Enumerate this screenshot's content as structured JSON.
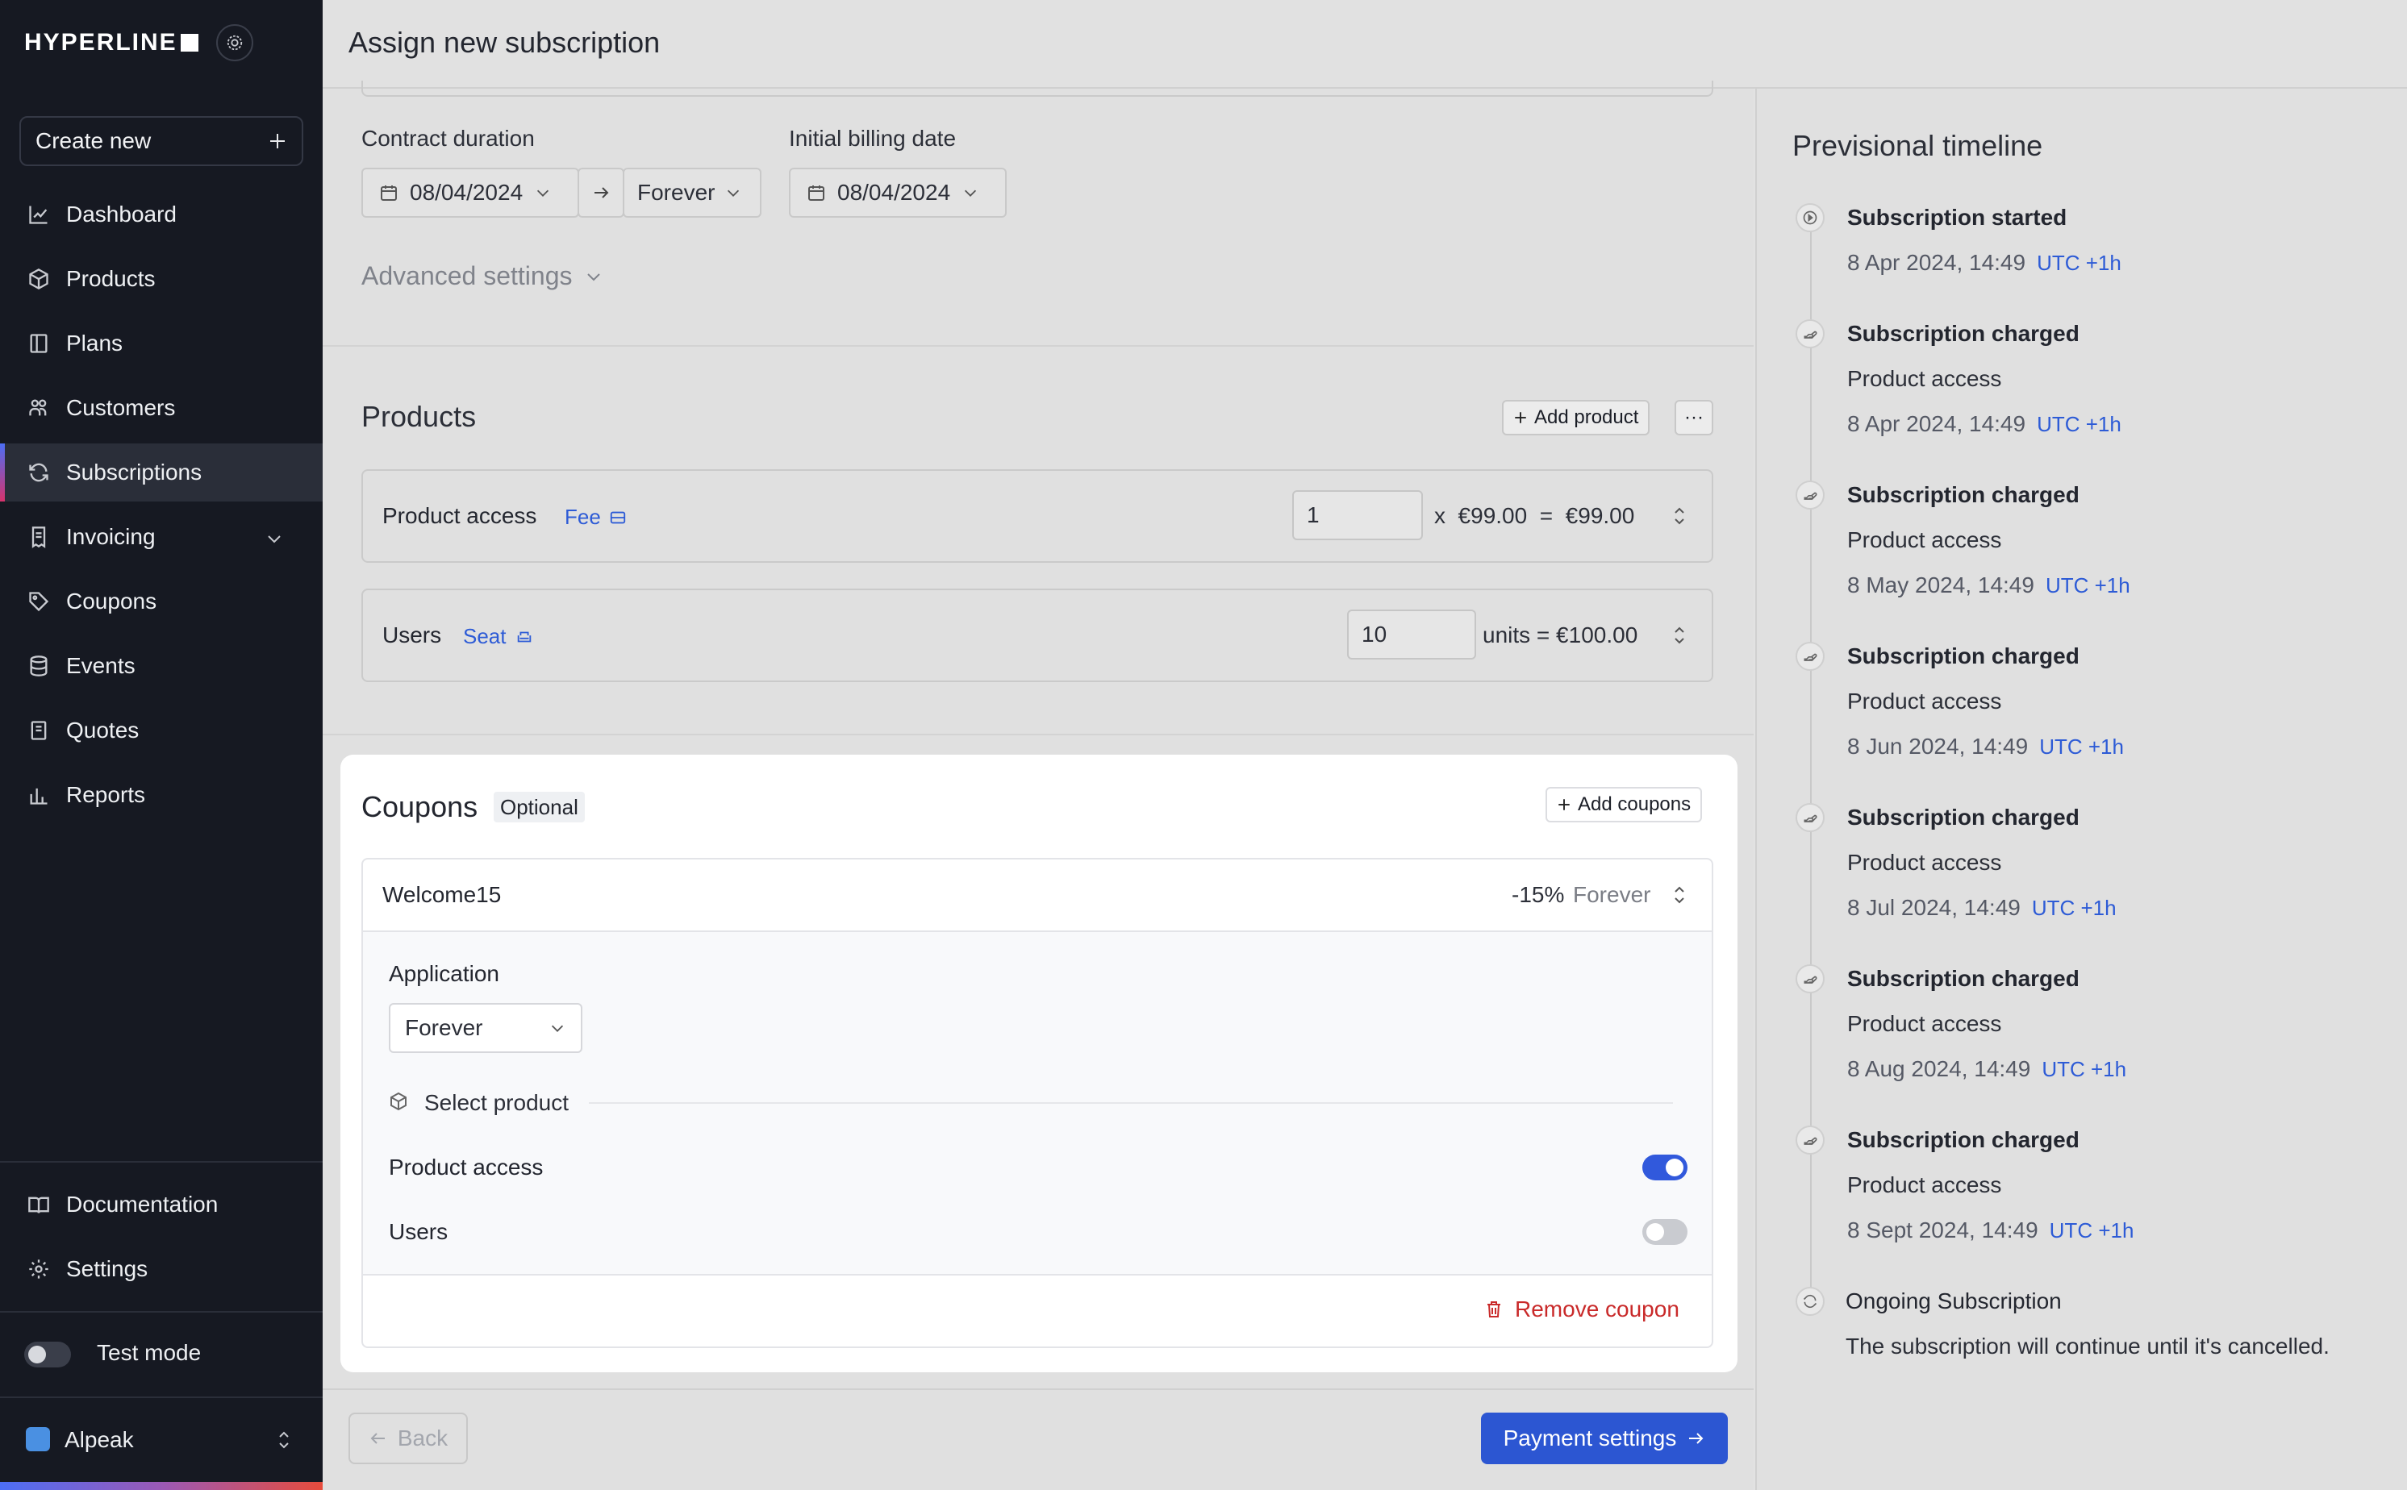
{
  "app": {
    "brand": "HYPERLINE",
    "title": "Assign new subscription"
  },
  "sidebar": {
    "create_new": "Create new",
    "items": [
      {
        "label": "Dashboard",
        "icon": "chart-line-icon"
      },
      {
        "label": "Products",
        "icon": "cube-icon"
      },
      {
        "label": "Plans",
        "icon": "plan-icon"
      },
      {
        "label": "Customers",
        "icon": "users-icon"
      },
      {
        "label": "Subscriptions",
        "icon": "refresh-icon",
        "active": true
      },
      {
        "label": "Invoicing",
        "icon": "receipt-icon"
      },
      {
        "label": "Coupons",
        "icon": "tag-icon"
      },
      {
        "label": "Events",
        "icon": "database-icon"
      },
      {
        "label": "Quotes",
        "icon": "document-icon"
      },
      {
        "label": "Reports",
        "icon": "bar-chart-icon"
      }
    ],
    "bottom_items": [
      {
        "label": "Documentation",
        "icon": "book-icon"
      },
      {
        "label": "Settings",
        "icon": "gear-icon"
      }
    ],
    "test_mode": "Test mode",
    "org_name": "Alpeak"
  },
  "contract": {
    "duration_label": "Contract duration",
    "start_date": "08/04/2024",
    "end_value": "Forever",
    "billing_label": "Initial billing date",
    "billing_date": "08/04/2024",
    "advanced": "Advanced settings"
  },
  "products": {
    "title": "Products",
    "add_button": "Add product",
    "more": "···",
    "rows": [
      {
        "name": "Product access",
        "type": "Fee",
        "qty": "1",
        "price_text": "x  €99.00  =  €99.00"
      },
      {
        "name": "Users",
        "type": "Seat",
        "qty": "10",
        "price_text": "units = €100.00"
      }
    ]
  },
  "coupons": {
    "title": "Coupons",
    "badge": "Optional",
    "add_button": "Add coupons",
    "coupon_name": "Welcome15",
    "discount": "-15%",
    "duration": "Forever",
    "application_label": "Application",
    "application_value": "Forever",
    "select_product": "Select product",
    "products": [
      {
        "name": "Product access",
        "enabled": true
      },
      {
        "name": "Users",
        "enabled": false
      }
    ],
    "remove": "Remove coupon"
  },
  "timeline": {
    "title": "Previsional timeline",
    "events": [
      {
        "title": "Subscription started",
        "sub": "",
        "date": "8 Apr 2024, 14:49",
        "tz": "UTC +1h"
      },
      {
        "title": "Subscription charged",
        "sub": "Product access",
        "date": "8 Apr 2024, 14:49",
        "tz": "UTC +1h"
      },
      {
        "title": "Subscription charged",
        "sub": "Product access",
        "date": "8 May 2024, 14:49",
        "tz": "UTC +1h"
      },
      {
        "title": "Subscription charged",
        "sub": "Product access",
        "date": "8 Jun 2024, 14:49",
        "tz": "UTC +1h"
      },
      {
        "title": "Subscription charged",
        "sub": "Product access",
        "date": "8 Jul 2024, 14:49",
        "tz": "UTC +1h"
      },
      {
        "title": "Subscription charged",
        "sub": "Product access",
        "date": "8 Aug 2024, 14:49",
        "tz": "UTC +1h"
      },
      {
        "title": "Subscription charged",
        "sub": "Product access",
        "date": "8 Sept 2024, 14:49",
        "tz": "UTC +1h"
      }
    ],
    "ongoing_title": "Ongoing Subscription",
    "ongoing_sub": "The subscription will continue until it's cancelled."
  },
  "footer": {
    "back": "Back",
    "next": "Payment settings"
  }
}
